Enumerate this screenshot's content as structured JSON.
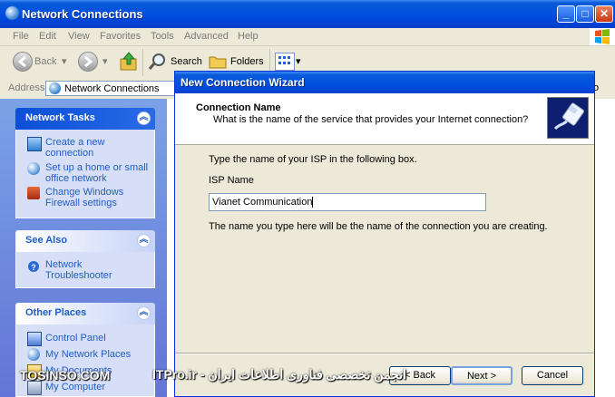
{
  "window": {
    "title": "Network Connections",
    "icon": "network-connections-icon"
  },
  "menu": {
    "items": [
      "File",
      "Edit",
      "View",
      "Favorites",
      "Tools",
      "Advanced",
      "Help"
    ]
  },
  "toolbar": {
    "back": "Back",
    "search": "Search",
    "folders": "Folders"
  },
  "address": {
    "label": "Address",
    "value": "Network Connections",
    "go_fragment": "o"
  },
  "tasks": {
    "network_tasks": {
      "title": "Network Tasks",
      "items": [
        [
          "Create a new",
          "connection"
        ],
        [
          "Set up a home or small",
          "office network"
        ],
        [
          "Change Windows",
          "Firewall settings"
        ]
      ]
    },
    "see_also": {
      "title": "See Also",
      "items": [
        [
          "Network",
          "Troubleshooter"
        ]
      ]
    },
    "other_places": {
      "title": "Other Places",
      "items": [
        "Control Panel",
        "My Network Places",
        "My Documents",
        "My Computer"
      ]
    }
  },
  "wizard": {
    "title": "New Connection Wizard",
    "header_title": "Connection Name",
    "header_subtitle": "What is the name of the service that provides your Internet connection?",
    "instruction": "Type the name of your ISP in the following box.",
    "field_label": "ISP Name",
    "field_value": "Vianet Communication",
    "note": "The name you type here will be the name of the connection you are creating.",
    "back_label": "< Back",
    "next_label": "Next >",
    "cancel_label": "Cancel"
  },
  "watermark": {
    "left": "TOSINSO.COM",
    "right": "انجمن تخصصی فناوری اطلاعات ایران - ITPro.ir"
  },
  "colors": {
    "xp_blue": "#0050e0",
    "task_link": "#215dc6",
    "dialog_bg": "#ece9d8"
  }
}
